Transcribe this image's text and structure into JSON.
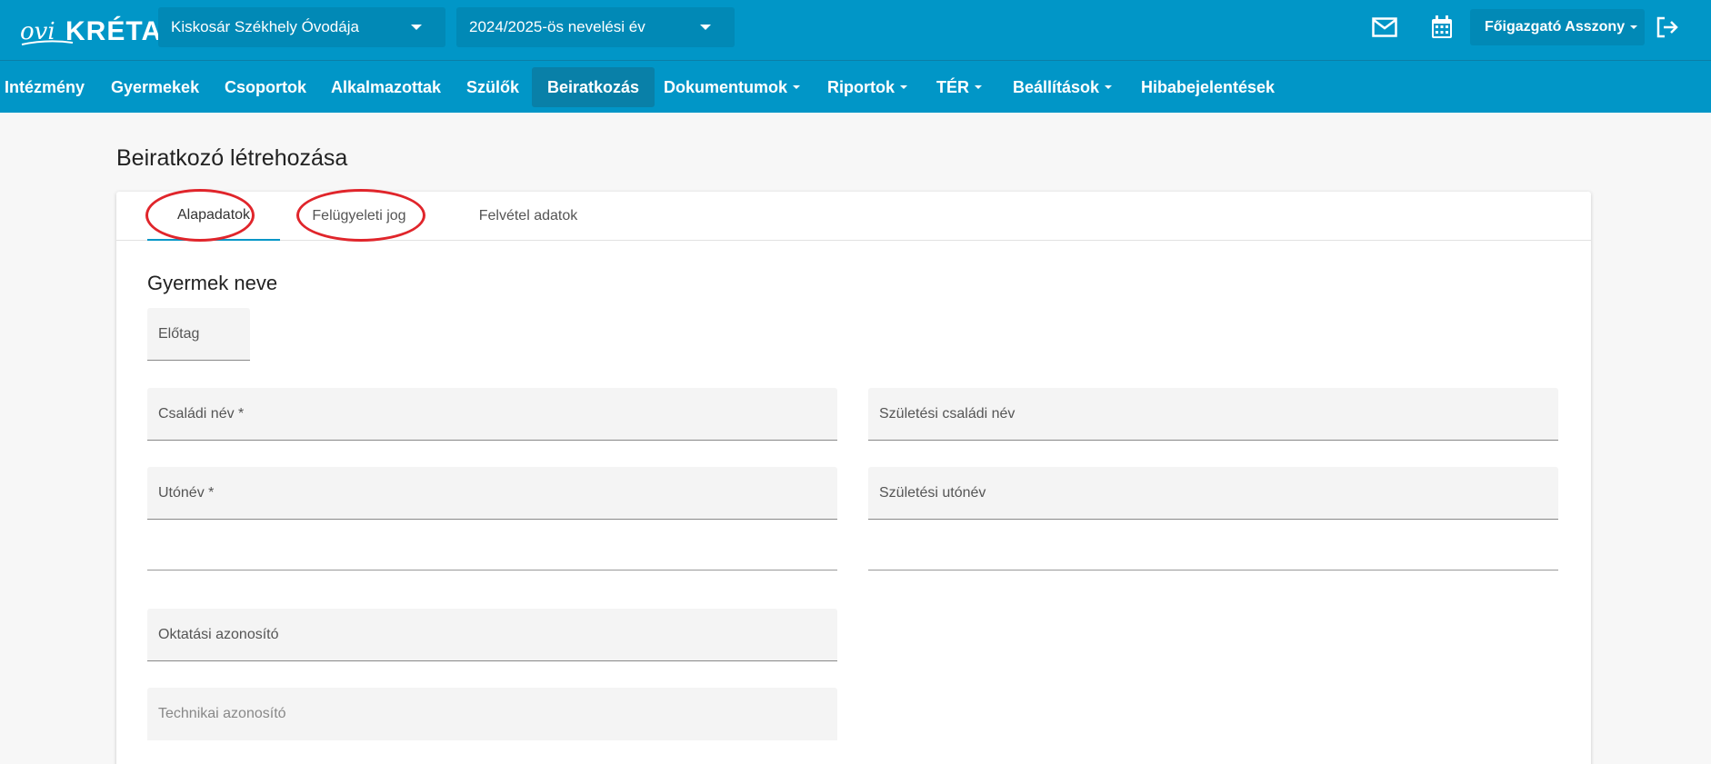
{
  "header": {
    "logo_ovi": "ovi",
    "logo_kreta": "KRÉTA",
    "school_select": "Kiskosár Székhely Óvodája",
    "year_select": "2024/2025-ös nevelési év",
    "user_name": "Főigazgató Asszony"
  },
  "nav": {
    "items": [
      {
        "label": "Intézmény"
      },
      {
        "label": "Gyermekek"
      },
      {
        "label": "Csoportok"
      },
      {
        "label": "Alkalmazottak"
      },
      {
        "label": "Szülők"
      },
      {
        "label": "Beiratkozás",
        "active": true
      },
      {
        "label": "Dokumentumok",
        "dropdown": true
      },
      {
        "label": "Riportok",
        "dropdown": true
      },
      {
        "label": "TÉR",
        "dropdown": true
      },
      {
        "label": "Beállítások",
        "dropdown": true
      },
      {
        "label": "Hibabejelentések"
      }
    ]
  },
  "page": {
    "title": "Beiratkozó létrehozása",
    "tabs": [
      {
        "label": "Alapadatok",
        "active": true
      },
      {
        "label": "Felügyeleti jog"
      },
      {
        "label": "Felvétel adatok"
      }
    ],
    "section_title": "Gyermek neve",
    "fields": {
      "prefix": "Előtag",
      "family_name": "Családi név *",
      "birth_family_name": "Születési családi név",
      "given_name": "Utónév *",
      "birth_given_name": "Születési utónév",
      "education_id": "Oktatási azonosító",
      "technical_id": "Technikai azonosító"
    }
  },
  "colors": {
    "header_bg": "#0196c7",
    "active_nav_bg": "#0980a8",
    "highlight_ring": "#e0252b"
  }
}
